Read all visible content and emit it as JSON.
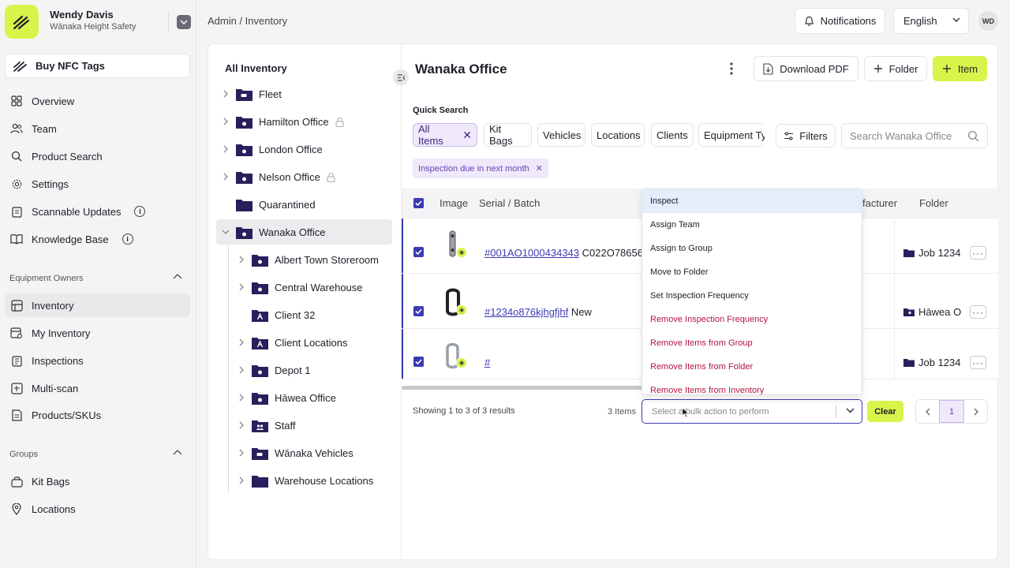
{
  "user": {
    "name": "Wendy Davis",
    "org": "Wānaka Height Safety",
    "initials": "WD"
  },
  "sidebar": {
    "buy_label": "Buy NFC Tags",
    "main_items": [
      {
        "label": "Overview",
        "icon": "grid-icon"
      },
      {
        "label": "Team",
        "icon": "users-icon"
      },
      {
        "label": "Product Search",
        "icon": "search-icon"
      },
      {
        "label": "Settings",
        "icon": "gear-icon"
      },
      {
        "label": "Scannable Updates",
        "icon": "clipboard-icon",
        "info": "i"
      },
      {
        "label": "Knowledge Base",
        "icon": "book-icon",
        "info": "i"
      }
    ],
    "section_owners": "Equipment Owners",
    "owner_items": [
      {
        "label": "Inventory",
        "icon": "inventory-icon",
        "active": true
      },
      {
        "label": "My Inventory",
        "icon": "my-inventory-icon"
      },
      {
        "label": "Inspections",
        "icon": "clipboard-check-icon"
      },
      {
        "label": "Multi-scan",
        "icon": "multiscan-icon"
      },
      {
        "label": "Products/SKUs",
        "icon": "document-icon"
      }
    ],
    "section_groups": "Groups",
    "group_items": [
      {
        "label": "Kit Bags",
        "icon": "bag-icon"
      },
      {
        "label": "Locations",
        "icon": "location-pin-icon"
      }
    ]
  },
  "header": {
    "breadcrumb": "Admin /  Inventory",
    "notifications_label": "Notifications",
    "language": "English"
  },
  "tree": {
    "title": "All Inventory",
    "items": [
      {
        "label": "Fleet"
      },
      {
        "label": "Hamilton Office",
        "locked": true
      },
      {
        "label": "London Office"
      },
      {
        "label": "Nelson Office",
        "locked": true
      },
      {
        "label": "Quarantined"
      },
      {
        "label": "Wanaka Office",
        "selected": true
      },
      {
        "label": "Albert Town Storeroom"
      },
      {
        "label": "Central Warehouse"
      },
      {
        "label": "Client 32"
      },
      {
        "label": "Client Locations"
      },
      {
        "label": "Depot 1"
      },
      {
        "label": "Hāwea Office"
      },
      {
        "label": "Staff"
      },
      {
        "label": "Wānaka Vehicles"
      },
      {
        "label": "Warehouse Locations"
      }
    ]
  },
  "main": {
    "title": "Wanaka Office",
    "download_label": "Download PDF",
    "folder_label": "Folder",
    "item_label": "Item",
    "quick_search_label": "Quick Search",
    "chips": [
      "All Items",
      "Kit Bags",
      "Vehicles",
      "Locations",
      "Clients",
      "Equipment Ty"
    ],
    "filters_label": "Filters",
    "search_placeholder": "Search Wanaka Office",
    "active_filter": "Inspection due in next month",
    "columns": {
      "image": "Image",
      "serial": "Serial / Batch",
      "manufacturer": "facturer",
      "folder": "Folder"
    },
    "rows": [
      {
        "serial_link": "#001AO1000434343",
        "serial_rest": " C022O78656",
        "folder": "Job 1234"
      },
      {
        "serial_link": "#1234o876kjhgfjhf",
        "serial_rest": " New",
        "folder": "Hāwea O"
      },
      {
        "serial_link": "#",
        "serial_rest": "",
        "folder": "Job 1234"
      }
    ],
    "showing": "Showing 1 to 3 of 3 results",
    "items_count": "3 Items",
    "bulk_placeholder": "Select a bulk action to perform",
    "clear_label": "Clear",
    "page": "1",
    "bulk_actions": [
      {
        "label": "Inspect",
        "highlight": true
      },
      {
        "label": "Assign Team"
      },
      {
        "label": "Assign to Group"
      },
      {
        "label": "Move to Folder"
      },
      {
        "label": "Set Inspection Frequency"
      },
      {
        "label": "Remove Inspection Frequency",
        "danger": true
      },
      {
        "label": "Remove Items from Group",
        "danger": true
      },
      {
        "label": "Remove Items from Folder",
        "danger": true
      },
      {
        "label": "Remove Items from Inventory",
        "danger": true
      }
    ]
  },
  "colors": {
    "accent": "#d7f44a",
    "primary": "#3b3bb3",
    "folder": "#2a1f5c",
    "danger": "#b3173e",
    "chip_active": "#efe9fb"
  }
}
